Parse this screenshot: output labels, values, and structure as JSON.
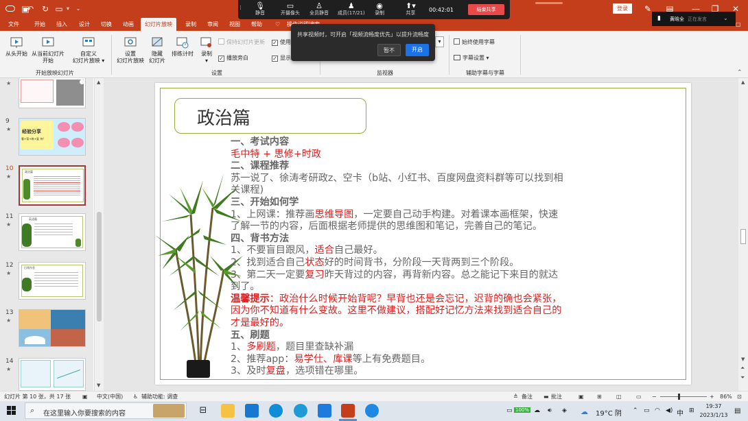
{
  "window": {
    "signin": "登录",
    "window_controls": [
      "minimize-icon",
      "restore-icon",
      "close-icon"
    ]
  },
  "tabs": [
    "文件",
    "开始",
    "插入",
    "设计",
    "切换",
    "动画",
    "幻灯片放映",
    "录制",
    "审阅",
    "视图",
    "帮助",
    "操作说明搜索"
  ],
  "active_tab": "幻灯片放映",
  "ribbon": {
    "from_start": "从头开始",
    "from_current_l1": "从当前幻灯片",
    "from_current_l2": "开始",
    "custom_l1": "自定义",
    "custom_l2": "幻灯片放映",
    "group_start": "开始放映幻灯片",
    "setup_l1": "设置",
    "setup_l2": "幻灯片放映",
    "hide_l1": "隐藏",
    "hide_l2": "幻灯片",
    "rehearse": "排练计时",
    "record": "录制",
    "keep_updated": "保持幻灯片更新",
    "use_timing": "使用计时",
    "play_narration": "播放旁白",
    "show_controls": "显示媒体控件",
    "group_setup": "设置",
    "group_monitor": "监视器",
    "always_subtitles": "始终使用字幕",
    "subtitle_settings": "字幕设置",
    "group_captions": "辅助字幕与字幕"
  },
  "meeting": {
    "items": [
      "静音",
      "开摄像头",
      "全员静音",
      "成员(17/21)",
      "录制",
      "共享"
    ],
    "icons": [
      "mic-icon",
      "camera-icon",
      "mute-all-icon",
      "members-icon",
      "record-icon",
      "share-icon"
    ],
    "timer": "00:42:01",
    "end_share": "结束共享",
    "popup_message": "共享视频时，可开启「视频流畅度优先」以提升流畅度",
    "popup_later": "暂不",
    "popup_enable": "开启",
    "presenter": "黄晗全",
    "presenter_status": "正在发言"
  },
  "thumbnails": [
    {
      "num": "9",
      "caption": "经验分享",
      "sub": "看+背+练+复 持!"
    },
    {
      "num": "10",
      "caption": "政治篇"
    },
    {
      "num": "11",
      "caption": "英语篇"
    },
    {
      "num": "12",
      "caption": "日常作息"
    },
    {
      "num": "13",
      "caption": ""
    },
    {
      "num": "14",
      "caption": ""
    }
  ],
  "slide": {
    "title": "政治篇",
    "lines": [
      {
        "type": "h",
        "parts": [
          {
            "t": "一、考试内容"
          }
        ]
      },
      {
        "type": "red",
        "parts": [
          {
            "t": "毛中特 + 思修+时政"
          }
        ]
      },
      {
        "type": "h",
        "parts": [
          {
            "t": "二、课程推荐"
          }
        ]
      },
      {
        "type": "n",
        "parts": [
          {
            "t": "苏一说了、徐涛考研政z、空卡（b站、小红书、百度网盘资料群等可以找到相"
          }
        ]
      },
      {
        "type": "n",
        "parts": [
          {
            "t": "关课程)"
          }
        ]
      },
      {
        "type": "h",
        "parts": [
          {
            "t": "三、开始如何学"
          }
        ]
      },
      {
        "type": "n",
        "parts": [
          {
            "t": "1、上网课：推荐画"
          },
          {
            "t": "思维导图",
            "r": true
          },
          {
            "t": "，一定要自己动手构建。对着课本画框架，快速"
          }
        ]
      },
      {
        "type": "n",
        "parts": [
          {
            "t": "了解一节的内容，后面根据老师提供的思维图和笔记，完善自己的笔记。"
          }
        ]
      },
      {
        "type": "h",
        "parts": [
          {
            "t": "四、背书方法"
          }
        ]
      },
      {
        "type": "n",
        "parts": [
          {
            "t": "1、不要盲目跟风，"
          },
          {
            "t": "适合",
            "r": true
          },
          {
            "t": "自己最好。"
          }
        ]
      },
      {
        "type": "n",
        "parts": [
          {
            "t": "2、找到适合自己"
          },
          {
            "t": "状态",
            "r": true
          },
          {
            "t": "好的时间背书，分阶段一天背两到三个阶段。"
          }
        ]
      },
      {
        "type": "n",
        "parts": [
          {
            "t": "3、第二天一定要"
          },
          {
            "t": "复习",
            "r": true
          },
          {
            "t": "昨天背过的内容，再背新内容。总之能记下来目的就达"
          }
        ]
      },
      {
        "type": "n",
        "parts": [
          {
            "t": "到了。"
          }
        ]
      },
      {
        "type": "red",
        "parts": [
          {
            "t": "温馨提示",
            "b": true
          },
          {
            "t": "：政治什么时候开始背呢？早背也还是会忘记，迟背的确也会紧张，"
          }
        ]
      },
      {
        "type": "red",
        "parts": [
          {
            "t": "因为你不知道有什么变故。这里不做建议，搭配好记忆方法来找到适合自己的"
          }
        ]
      },
      {
        "type": "red",
        "parts": [
          {
            "t": "才是最好的。"
          }
        ]
      },
      {
        "type": "h",
        "parts": [
          {
            "t": "五、刷题"
          }
        ]
      },
      {
        "type": "n",
        "parts": [
          {
            "t": "1、"
          },
          {
            "t": "多刷题",
            "r": true
          },
          {
            "t": "，题目里查缺补漏"
          }
        ]
      },
      {
        "type": "n",
        "parts": [
          {
            "t": "2、推荐app："
          },
          {
            "t": "易学仕、库课",
            "r": true
          },
          {
            "t": "等上有免费题目。"
          }
        ]
      },
      {
        "type": "n",
        "parts": [
          {
            "t": "3、及时"
          },
          {
            "t": "复盘",
            "r": true
          },
          {
            "t": "，选项错在哪里。"
          }
        ]
      }
    ]
  },
  "status": {
    "slide_info": "幻灯片 第 10 张，共 17 张",
    "language": "中文(中国)",
    "accessibility": "辅助功能: 调查",
    "notes": "备注",
    "comments": "批注",
    "zoom": "86%"
  },
  "taskbar": {
    "search_placeholder": "在这里输入你要搜索的内容",
    "battery": "100%",
    "weather": "19°C  阴",
    "ime": "中",
    "time": "19:37",
    "date": "2023/1/13"
  },
  "colors": {
    "accent": "#c43e1c",
    "slide_border": "#9aaa38",
    "emphasis_red": "#e02020"
  }
}
